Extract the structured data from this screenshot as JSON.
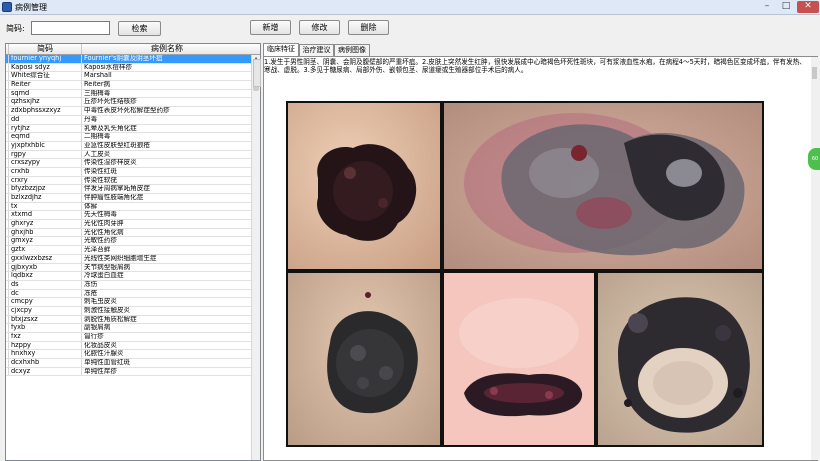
{
  "window": {
    "title": "病例管理"
  },
  "toolbar": {
    "search_label": "简码:",
    "search_value": "",
    "search_button": "检索",
    "add_button": "新增",
    "edit_button": "修改",
    "delete_button": "删除"
  },
  "grid": {
    "columns": [
      "简码",
      "病例名称"
    ],
    "rows": [
      [
        "fournier ynyqhj",
        "Fournier's阴囊及阴茎坏疽"
      ],
      [
        "Kaposi sdyz",
        "Kaposi水痘样疹"
      ],
      [
        "White综合征",
        "Marshall"
      ],
      [
        "Reiter",
        "Reiter病"
      ],
      [
        "sqmd",
        "三期梅毒"
      ],
      [
        "qzhsxjhz",
        "丘疹坏死性结核疹"
      ],
      [
        "zdxbphssxzxyz",
        "中毒性表皮坏死松解症型药疹"
      ],
      [
        "dd",
        "丹毒"
      ],
      [
        "rytjhz",
        "乳晕及乳头角化症"
      ],
      [
        "eqmd",
        "二期梅毒"
      ],
      [
        "yjxpfxhblc",
        "亚急性皮肤型红斑狼疮"
      ],
      [
        "rgpy",
        "人工皮炎"
      ],
      [
        "crxszypy",
        "传染性湿疹样皮炎"
      ],
      [
        "crxhb",
        "传染性红斑"
      ],
      [
        "crxry",
        "传染性软疣"
      ],
      [
        "bfyzbzzjpz",
        "伴发牙周病掌跖角皮症"
      ],
      [
        "bzlxzdjhz",
        "伴肿瘤性肢端角化症"
      ],
      [
        "tx",
        "体癣"
      ],
      [
        "xtxmd",
        "先天性梅毒"
      ],
      [
        "ghxryz",
        "光化性肉芽肿"
      ],
      [
        "ghxjhb",
        "光化性角化病"
      ],
      [
        "gmxyz",
        "光敏性药疹"
      ],
      [
        "gztx",
        "光泽苔藓"
      ],
      [
        "gxxlwzxbzsz",
        "光线性类网织细胞增生症"
      ],
      [
        "gjbxyxb",
        "关节病型银屑病"
      ],
      [
        "lqdbxz",
        "冷球蛋白血症"
      ],
      [
        "ds",
        "冻伤"
      ],
      [
        "dc",
        "冻疮"
      ],
      [
        "cmcpy",
        "刺毛虫皮炎"
      ],
      [
        "cjxcpy",
        "刺激性接触皮炎"
      ],
      [
        "btxjzsxz",
        "剥脱性角质松解症"
      ],
      [
        "fyxb",
        "副银屑病"
      ],
      [
        "fxz",
        "匐行疹"
      ],
      [
        "hzppy",
        "化妆品皮炎"
      ],
      [
        "hnxhxy",
        "化脓性汗腺炎"
      ],
      [
        "dcxhxhb",
        "单纯性血管红斑"
      ],
      [
        "dcxyz",
        "单纯性痒疹"
      ]
    ]
  },
  "tabs": [
    "临床特征",
    "治疗建议",
    "病例图像"
  ],
  "description": "1.发生于男性阴茎、阴囊、会阴及腹壁部的严重坏疽。2.皮肤上突然发生红肿，很快发展成中心暗褐色坏死性斑块，可有浆液血性水疱，在病程4～5天时，暗褐色区变成坏疽，伴有发热、寒战、虚脱。3.多见于糖尿病、局部外伤、嵌顿包茎、尿道瘘或生殖器部位手术后的病人。",
  "side_badge": "60"
}
